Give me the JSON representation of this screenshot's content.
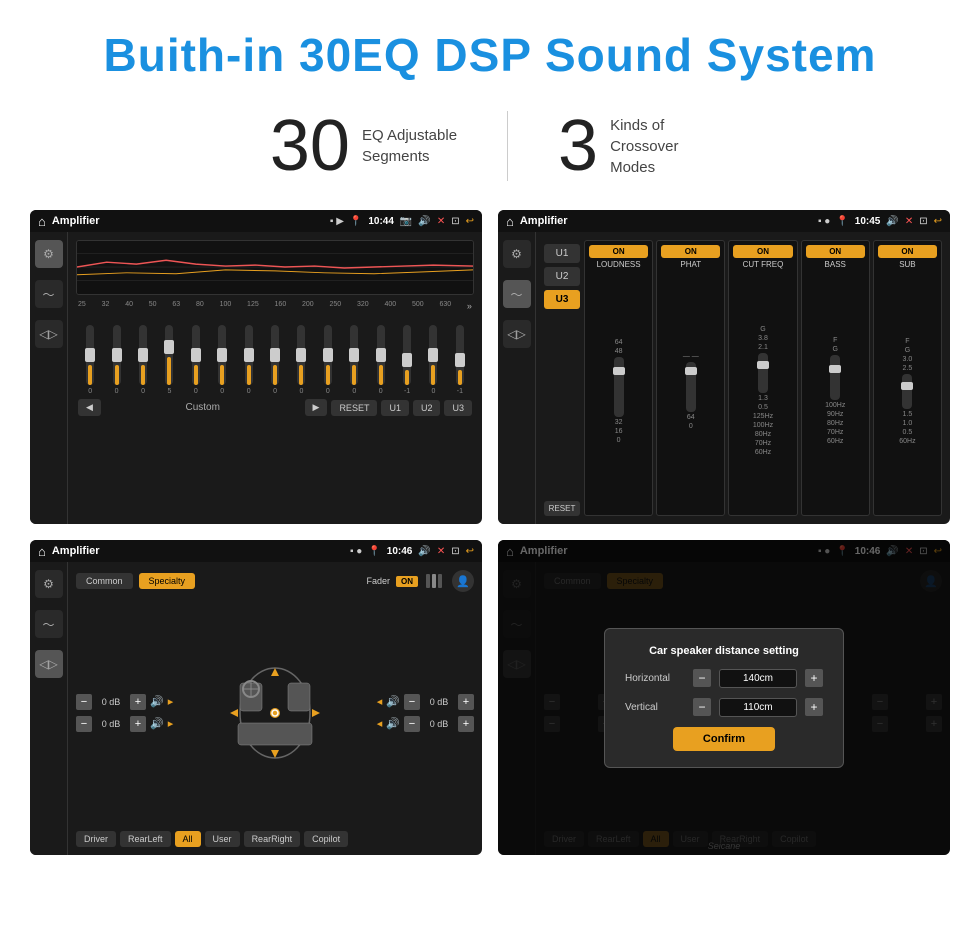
{
  "header": {
    "title": "Buith-in 30EQ DSP Sound System"
  },
  "stats": [
    {
      "number": "30",
      "label": "EQ Adjustable\nSegments"
    },
    {
      "number": "3",
      "label": "Kinds of\nCrossover Modes"
    }
  ],
  "screens": {
    "eq1": {
      "title": "Amplifier",
      "time": "10:44",
      "freq_labels": [
        "25",
        "32",
        "40",
        "50",
        "63",
        "80",
        "100",
        "125",
        "160",
        "200",
        "250",
        "320",
        "400",
        "500",
        "630"
      ],
      "sliders": [
        0,
        0,
        0,
        5,
        0,
        0,
        0,
        0,
        0,
        0,
        0,
        0,
        -1,
        0,
        -1
      ],
      "buttons": [
        "Custom",
        "RESET",
        "U1",
        "U2",
        "U3"
      ]
    },
    "eq2": {
      "title": "Amplifier",
      "time": "10:45",
      "channels": [
        "LOUDNESS",
        "PHAT",
        "CUT FREQ",
        "BASS",
        "SUB"
      ],
      "u_buttons": [
        "U1",
        "U2",
        "U3"
      ],
      "reset_label": "RESET"
    },
    "speaker1": {
      "title": "Amplifier",
      "time": "10:46",
      "preset_buttons": [
        "Common",
        "Specialty"
      ],
      "fader_label": "Fader",
      "positions": [
        "Driver",
        "RearLeft",
        "All",
        "User",
        "RearRight",
        "Copilot"
      ],
      "db_values": [
        "0 dB",
        "0 dB",
        "0 dB",
        "0 dB"
      ]
    },
    "speaker2": {
      "title": "Amplifier",
      "time": "10:46",
      "dialog": {
        "title": "Car speaker distance setting",
        "horizontal_label": "Horizontal",
        "horizontal_value": "140cm",
        "vertical_label": "Vertical",
        "vertical_value": "110cm",
        "confirm_label": "Confirm"
      }
    }
  },
  "watermark": "Seicane"
}
